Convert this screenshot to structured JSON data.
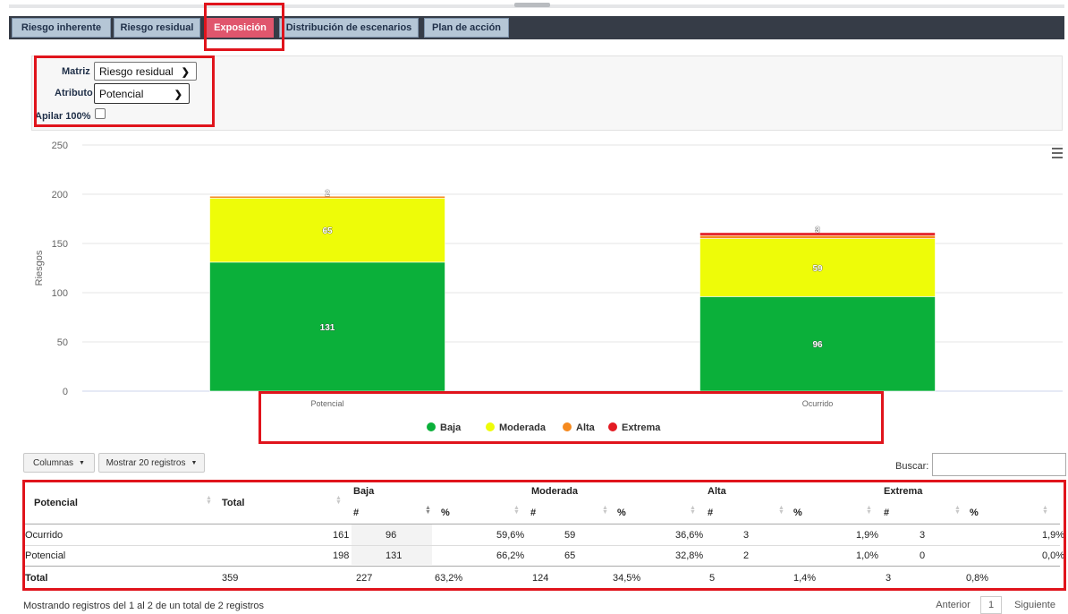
{
  "tabs": [
    {
      "label": "Riesgo inherente",
      "active": false
    },
    {
      "label": "Riesgo residual",
      "active": false
    },
    {
      "label": "Exposición",
      "active": true
    },
    {
      "label": "Distribución de escenarios",
      "active": false
    },
    {
      "label": "Plan de acción",
      "active": false
    }
  ],
  "filters": {
    "matriz_label": "Matriz",
    "matriz_value": "Riesgo residual",
    "atributo_label": "Atributo",
    "atributo_value": "Potencial",
    "apilar_label": "Apilar 100%",
    "apilar_checked": false
  },
  "chart_data": {
    "type": "bar",
    "stacked": true,
    "categories": [
      "Potencial",
      "Ocurrido"
    ],
    "series": [
      {
        "name": "Baja",
        "color": "#0bb03a",
        "values": [
          131,
          96
        ]
      },
      {
        "name": "Moderada",
        "color": "#eefc08",
        "values": [
          65,
          59
        ]
      },
      {
        "name": "Alta",
        "color": "#f58a1f",
        "values": [
          2,
          3
        ]
      },
      {
        "name": "Extrema",
        "color": "#e31b23",
        "values": [
          0,
          3
        ]
      }
    ],
    "ylabel": "Riesgos",
    "xlabel": "",
    "ylim": [
      0,
      250
    ],
    "yticks": [
      0,
      50,
      100,
      150,
      200,
      250
    ],
    "grid": true,
    "legend_position": "bottom"
  },
  "toolbar": {
    "columnas_label": "Columnas",
    "mostrar_label": "Mostrar 20 registros",
    "buscar_label": "Buscar:"
  },
  "table": {
    "header_potencial": "Potencial",
    "header_total": "Total",
    "groups": [
      "Baja",
      "Moderada",
      "Alta",
      "Extrema"
    ],
    "sub_count": "#",
    "sub_pct": "%",
    "rows": [
      {
        "name": "Ocurrido",
        "total": "161",
        "baja_n": "96",
        "baja_p": "59,6%",
        "mod_n": "59",
        "mod_p": "36,6%",
        "alta_n": "3",
        "alta_p": "1,9%",
        "ext_n": "3",
        "ext_p": "1,9%"
      },
      {
        "name": "Potencial",
        "total": "198",
        "baja_n": "131",
        "baja_p": "66,2%",
        "mod_n": "65",
        "mod_p": "32,8%",
        "alta_n": "2",
        "alta_p": "1,0%",
        "ext_n": "0",
        "ext_p": "0,0%"
      }
    ],
    "total_row": {
      "name": "Total",
      "total": "359",
      "baja_n": "227",
      "baja_p": "63,2%",
      "mod_n": "124",
      "mod_p": "34,5%",
      "alta_n": "5",
      "alta_p": "1,4%",
      "ext_n": "3",
      "ext_p": "0,8%"
    }
  },
  "footer": {
    "info": "Mostrando registros del 1 al 2 de un total de 2 registros",
    "prev": "Anterior",
    "page": "1",
    "next": "Siguiente"
  }
}
